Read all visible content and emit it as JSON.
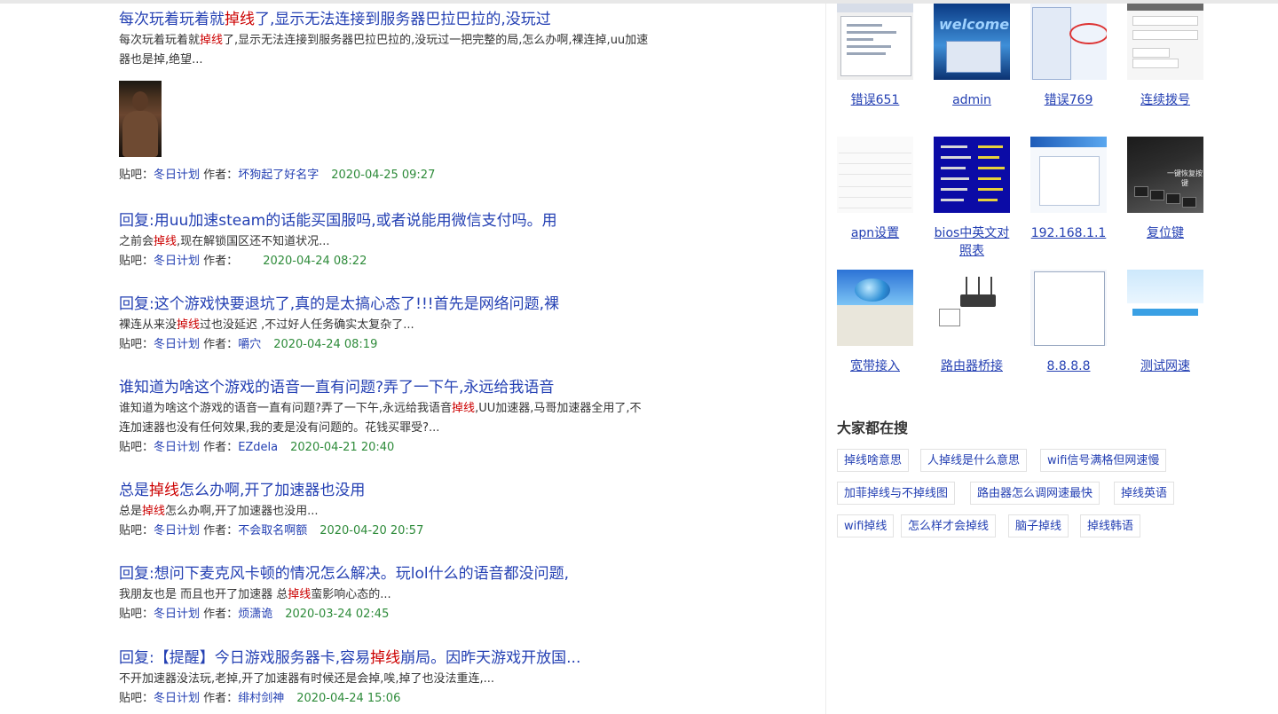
{
  "results": [
    {
      "title_parts": [
        "每次玩着玩着就",
        "掉线",
        "了,显示无法连接到服务器巴拉巴拉的,没玩过"
      ],
      "abstract_parts": [
        "每次玩着玩着就",
        "掉线",
        "了,显示无法连接到服务器巴拉巴拉的,没玩过一把完整的局,怎么办啊,裸连掉,uu加速器也是掉,绝望..."
      ],
      "has_thumb": true,
      "meta_prefix": "贴吧：",
      "forum": "冬日计划",
      "author_label": "作者：",
      "author": "坏狗起了好名字",
      "time": "2020-04-25 09:27"
    },
    {
      "title_parts": [
        "回复:用uu加速steam的话能买国服吗,或者说能用微信支付吗。用",
        "",
        ""
      ],
      "abstract_parts": [
        "之前会",
        "掉线",
        ",现在解锁国区还不知道状况..."
      ],
      "has_thumb": false,
      "meta_prefix": "贴吧：",
      "forum": "冬日计划",
      "author_label": "作者：",
      "author": "",
      "time": "2020-04-24 08:22"
    },
    {
      "title_parts": [
        "回复:这个游戏快要退坑了,真的是太搞心态了!!!首先是网络问题,裸",
        "",
        ""
      ],
      "abstract_parts": [
        "裸连从来没",
        "掉线",
        "过也没延迟 ,不过好人任务确实太复杂了..."
      ],
      "has_thumb": false,
      "meta_prefix": "贴吧：",
      "forum": "冬日计划",
      "author_label": "作者：",
      "author": "嚼穴",
      "time": "2020-04-24 08:19"
    },
    {
      "title_parts": [
        "谁知道为啥这个游戏的语音一直有问题?弄了一下午,永远给我语音",
        "",
        ""
      ],
      "abstract_parts": [
        "谁知道为啥这个游戏的语音一直有问题?弄了一下午,永远给我语音",
        "掉线",
        ",UU加速器,马哥加速器全用了,不连加速器也没有任何效果,我的麦是没有问题的。花钱买罪受?..."
      ],
      "has_thumb": false,
      "meta_prefix": "贴吧：",
      "forum": "冬日计划",
      "author_label": "作者：",
      "author": "EZdela",
      "time": "2020-04-21 20:40"
    },
    {
      "title_parts": [
        "总是",
        "掉线",
        "怎么办啊,开了加速器也没用"
      ],
      "abstract_parts": [
        "总是",
        "掉线",
        "怎么办啊,开了加速器也没用..."
      ],
      "has_thumb": false,
      "meta_prefix": "贴吧：",
      "forum": "冬日计划",
      "author_label": "作者：",
      "author": "不会取名啊额",
      "time": "2020-04-20 20:57"
    },
    {
      "title_parts": [
        "回复:想问下麦克风卡顿的情况怎么解决。玩lol什么的语音都没问题,",
        "",
        ""
      ],
      "abstract_parts": [
        "我朋友也是 而且也开了加速器 总",
        "掉线",
        "蛮影响心态的..."
      ],
      "has_thumb": false,
      "meta_prefix": "贴吧：",
      "forum": "冬日计划",
      "author_label": "作者：",
      "author": "烦潇诡",
      "time": "2020-03-24 02:45"
    },
    {
      "title_parts": [
        "回复:【提醒】今日游戏服务器卡,容易",
        "掉线",
        "崩局。因昨天游戏开放国..."
      ],
      "abstract_parts": [
        "不开加速器没法玩,老掉,开了加速器有时候还是会掉,唉,掉了也没法重连,...",
        "",
        ""
      ],
      "has_thumb": false,
      "meta_prefix": "贴吧：",
      "forum": "冬日计划",
      "author_label": "作者：",
      "author": "绯村剑神",
      "time": "2020-04-24 15:06"
    }
  ],
  "images": [
    {
      "caption": "错误651",
      "kind": "win"
    },
    {
      "caption": "admin",
      "kind": "blue",
      "overlay_text": "welcome"
    },
    {
      "caption": "错误769",
      "kind": "cfg"
    },
    {
      "caption": "连续拨号",
      "kind": "form"
    },
    {
      "caption": "apn设置",
      "kind": "phone"
    },
    {
      "caption": "bios中英文对照表",
      "kind": "bios"
    },
    {
      "caption": "192.168.1.1",
      "kind": "router"
    },
    {
      "caption": "复位键",
      "kind": "laptop",
      "overlay_text": "一键恢复按键"
    },
    {
      "caption": "宽带接入",
      "kind": "xp"
    },
    {
      "caption": "路由器桥接",
      "kind": "device"
    },
    {
      "caption": "8.8.8.8",
      "kind": "dlg"
    },
    {
      "caption": "测试网速",
      "kind": "speed"
    }
  ],
  "hot": {
    "title": "大家都在搜",
    "tags": [
      "掉线啥意思",
      "人掉线是什么意思",
      "wifi信号满格但网速慢",
      "加菲掉线与不掉线图",
      "路由器怎么调网速最快",
      "掉线英语",
      "wifi掉线",
      "怎么样才会掉线",
      "脑子掉线",
      "掉线韩语"
    ]
  }
}
